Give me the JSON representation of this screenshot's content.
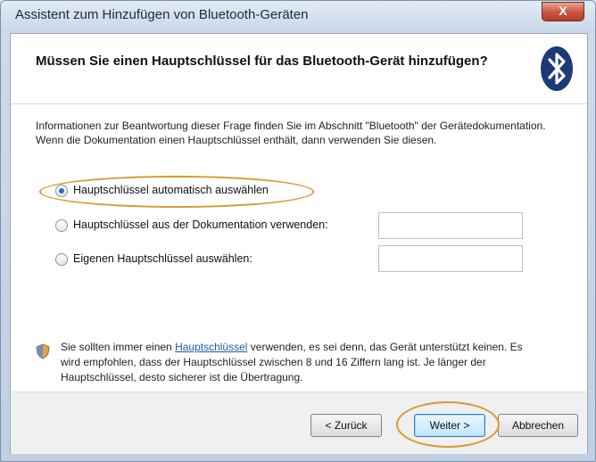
{
  "window": {
    "title": "Assistent zum Hinzufügen von Bluetooth-Geräten",
    "close_glyph": "X"
  },
  "header": {
    "heading": "Müssen Sie einen Hauptschlüssel für das Bluetooth-Gerät hinzufügen?",
    "icon": "bluetooth-icon"
  },
  "info_text": "Informationen zur Beantwortung dieser Frage finden Sie im Abschnitt \"Bluetooth\" der Gerätedokumentation. Wenn die Dokumentation einen Hauptschlüssel enthält, dann verwenden Sie diesen.",
  "options": [
    {
      "label": "Hauptschlüssel automatisch auswählen",
      "selected": true
    },
    {
      "label": "Hauptschlüssel aus der Dokumentation verwenden:",
      "selected": false,
      "value": ""
    },
    {
      "label": "Eigenen Hauptschlüssel auswählen:",
      "selected": false,
      "value": ""
    }
  ],
  "note": {
    "icon": "shield-icon",
    "prefix": "Sie sollten immer einen ",
    "link": "Hauptschlüssel",
    "suffix": " verwenden, es sei denn, das Gerät unterstützt keinen. Es wird empfohlen, dass der Hauptschlüssel zwischen 8 und 16 Ziffern lang ist. Je länger der Hauptschlüssel, desto sicherer ist die Übertragung."
  },
  "buttons": {
    "back": "< Zurück",
    "next": "Weiter >",
    "cancel": "Abbrechen"
  },
  "colors": {
    "highlight": "#d59a32",
    "link": "#1a5ca8",
    "accent": "#2f6db4"
  }
}
